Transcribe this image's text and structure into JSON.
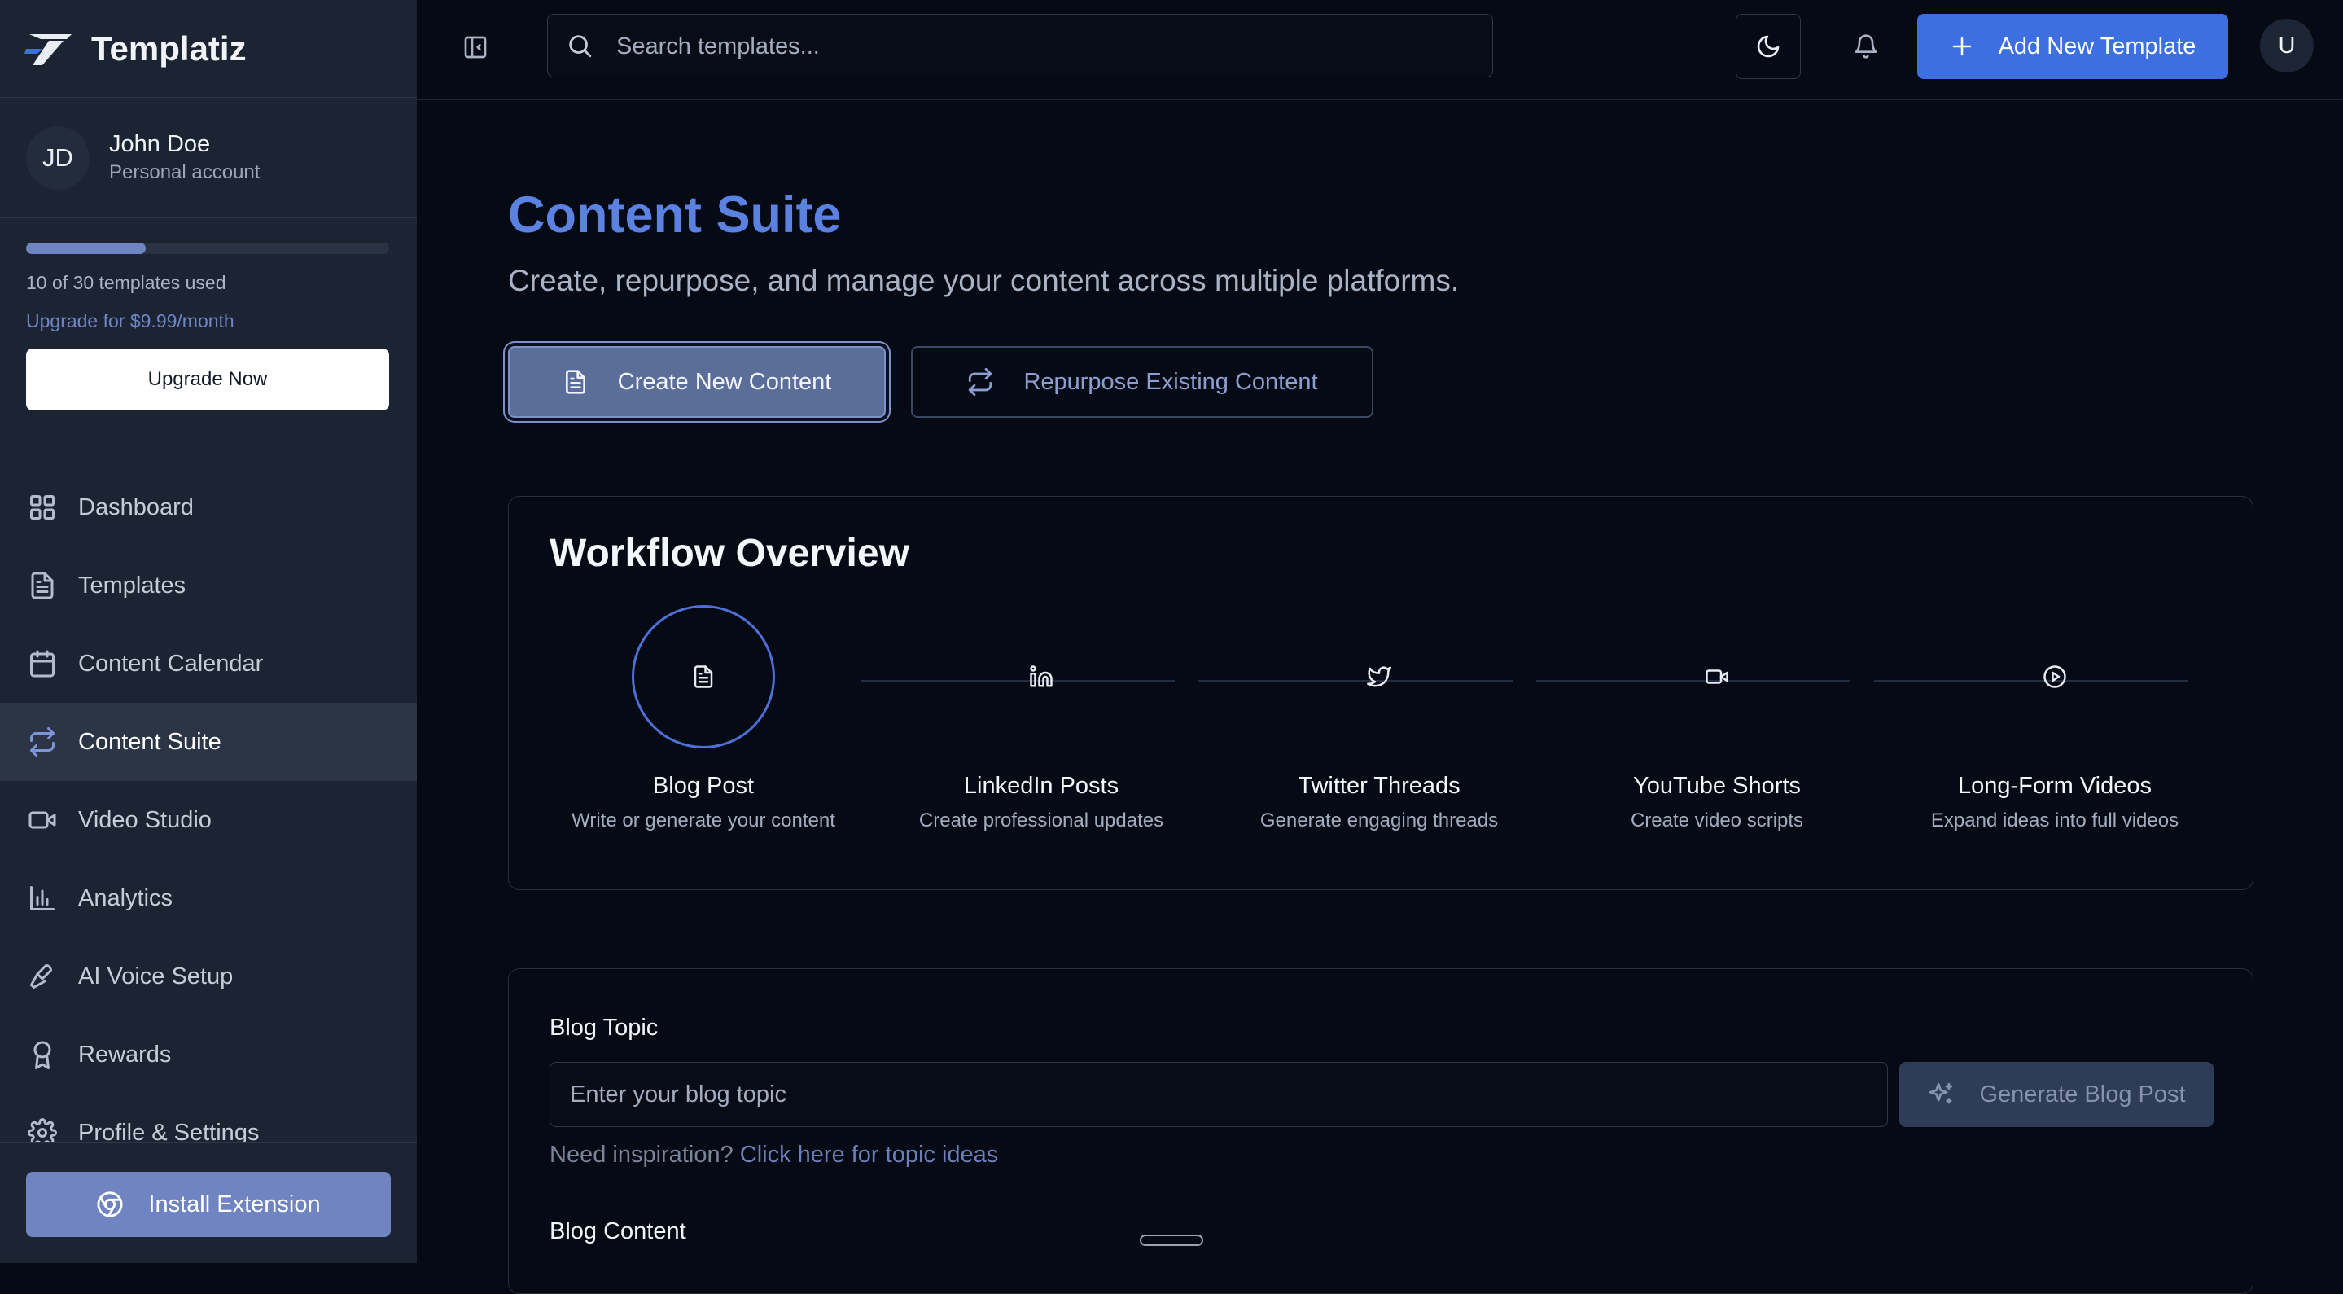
{
  "app": {
    "name": "Templatiz"
  },
  "account": {
    "initials": "JD",
    "name": "John Doe",
    "type": "Personal account"
  },
  "usage": {
    "used": 10,
    "total": 30,
    "progress_fraction": 0.33,
    "text": "10 of 30 templates used",
    "upgrade_text": "Upgrade for $9.99/month",
    "upgrade_button": "Upgrade Now"
  },
  "sidebar": {
    "items": [
      {
        "label": "Dashboard",
        "icon": "grid-icon"
      },
      {
        "label": "Templates",
        "icon": "file-text-icon"
      },
      {
        "label": "Content Calendar",
        "icon": "calendar-icon"
      },
      {
        "label": "Content Suite",
        "icon": "repeat-icon",
        "active": true
      },
      {
        "label": "Video Studio",
        "icon": "video-icon"
      },
      {
        "label": "Analytics",
        "icon": "bar-chart-icon"
      },
      {
        "label": "AI Voice Setup",
        "icon": "mic-icon"
      },
      {
        "label": "Rewards",
        "icon": "award-icon"
      },
      {
        "label": "Profile & Settings",
        "icon": "gear-icon"
      }
    ],
    "install_button": "Install Extension"
  },
  "topbar": {
    "search_placeholder": "Search templates...",
    "add_button": "Add New Template",
    "user_initial": "U"
  },
  "main": {
    "title": "Content Suite",
    "subtitle": "Create, repurpose, and manage your content across multiple platforms.",
    "create_button": "Create New Content",
    "repurpose_button": "Repurpose Existing Content"
  },
  "workflow": {
    "title": "Workflow Overview",
    "steps": [
      {
        "name": "Blog Post",
        "desc": "Write or generate your content",
        "icon": "file-text-icon",
        "active": true
      },
      {
        "name": "LinkedIn Posts",
        "desc": "Create professional updates",
        "icon": "linkedin-icon"
      },
      {
        "name": "Twitter Threads",
        "desc": "Generate engaging threads",
        "icon": "twitter-icon"
      },
      {
        "name": "YouTube Shorts",
        "desc": "Create video scripts",
        "icon": "video-icon"
      },
      {
        "name": "Long-Form Videos",
        "desc": "Expand ideas into full videos",
        "icon": "play-circle-icon"
      }
    ]
  },
  "blog": {
    "topic_label": "Blog Topic",
    "topic_placeholder": "Enter your blog topic",
    "generate_button": "Generate Blog Post",
    "inspiration_prefix": "Need inspiration?",
    "inspiration_link": "Click here for topic ideas",
    "content_label": "Blog Content"
  },
  "colors": {
    "accent": "#3d6fe0",
    "title": "#5b82e0",
    "background": "#050a14",
    "sidebar": "#1c2434"
  }
}
